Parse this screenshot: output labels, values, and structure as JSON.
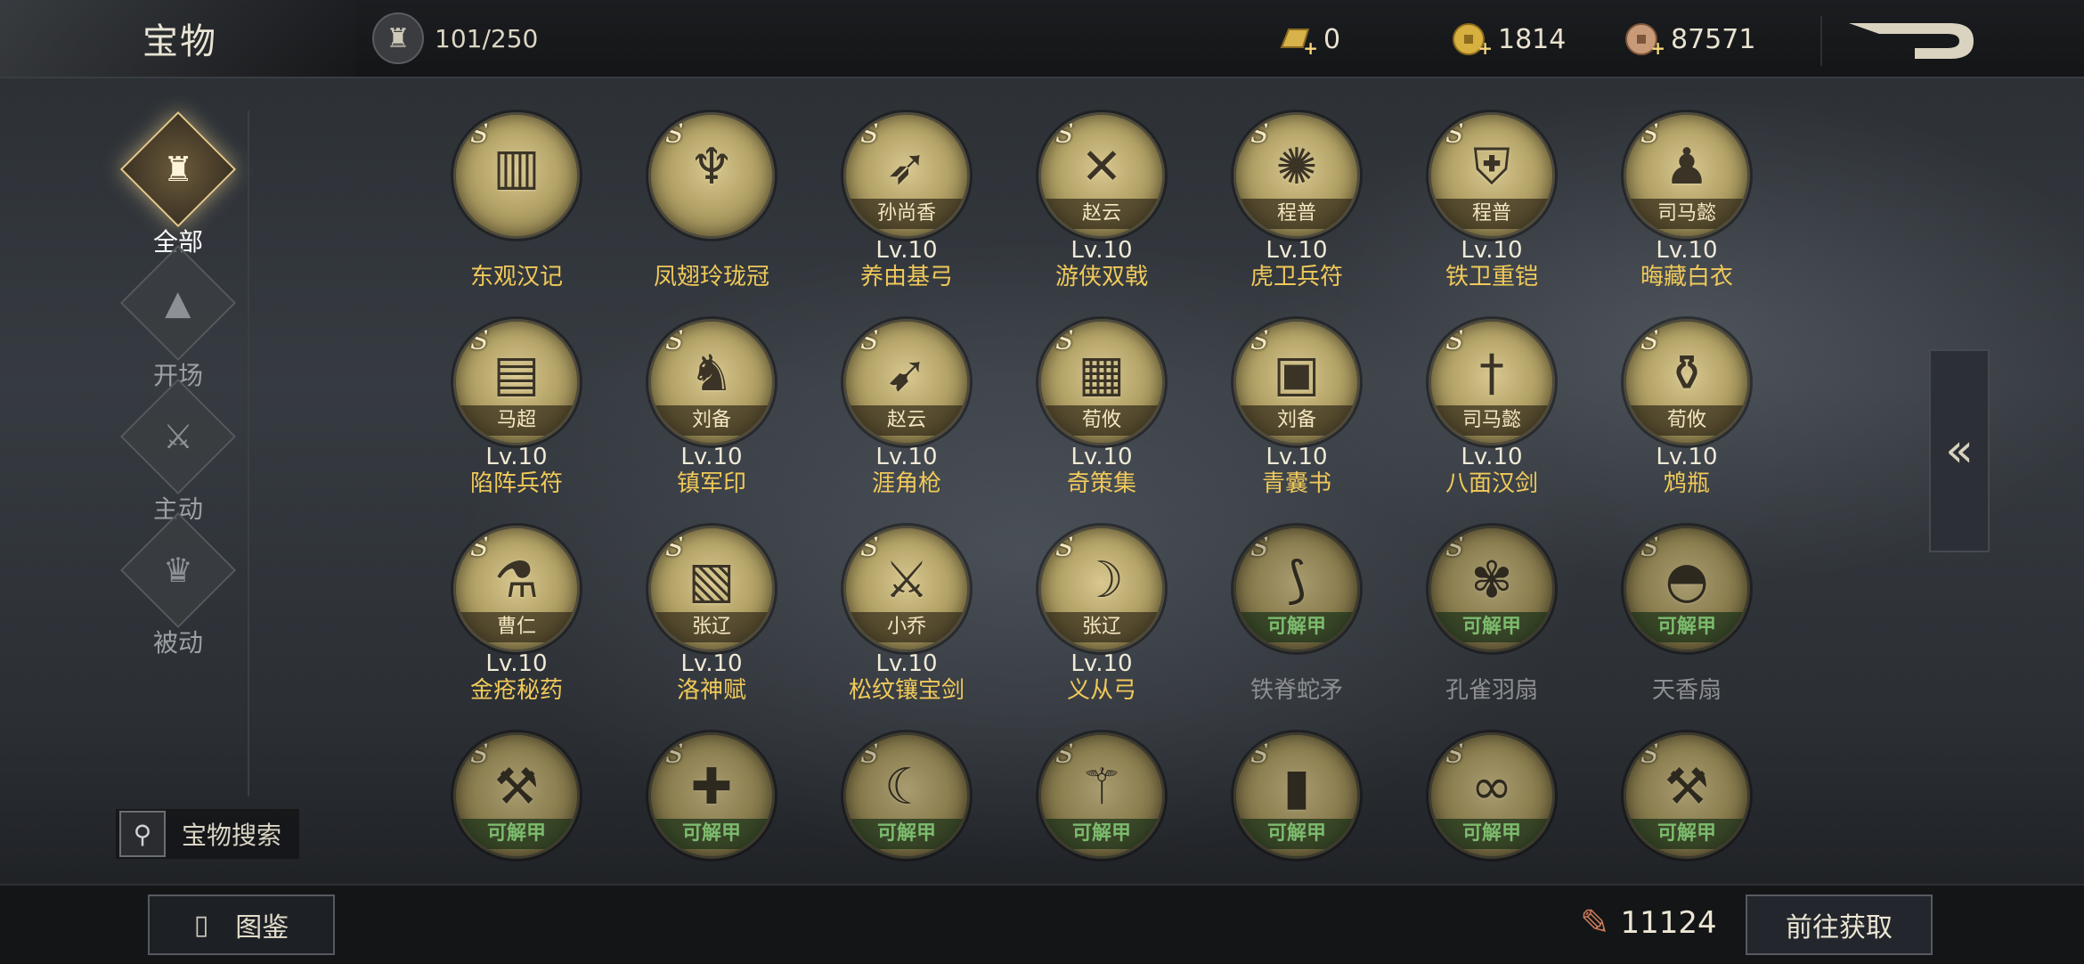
{
  "header": {
    "title": "宝物",
    "capacity": "101/250",
    "currencies": [
      {
        "icon": "gold-ingot-icon",
        "value": "0"
      },
      {
        "icon": "gold-coin-icon",
        "value": "1814"
      },
      {
        "icon": "copper-coin-icon",
        "value": "87571"
      }
    ]
  },
  "sidebar": {
    "items": [
      {
        "label": "全部",
        "icon": "all-category-icon",
        "active": true
      },
      {
        "label": "开场",
        "icon": "opening-category-icon",
        "active": false
      },
      {
        "label": "主动",
        "icon": "active-category-icon",
        "active": false
      },
      {
        "label": "被动",
        "icon": "passive-category-icon",
        "active": false
      }
    ],
    "search_label": "宝物搜索"
  },
  "treasures": [
    {
      "name": "东观汉记",
      "owner": "",
      "level": "",
      "locked": false,
      "icon": "books-icon"
    },
    {
      "name": "凤翅玲珑冠",
      "owner": "",
      "level": "",
      "locked": false,
      "icon": "phoenix-crown-icon"
    },
    {
      "name": "养由基弓",
      "owner": "孙尚香",
      "level": "Lv.10",
      "locked": false,
      "icon": "bow-icon"
    },
    {
      "name": "游侠双戟",
      "owner": "赵云",
      "level": "Lv.10",
      "locked": false,
      "icon": "twin-halberds-icon"
    },
    {
      "name": "虎卫兵符",
      "owner": "程普",
      "level": "Lv.10",
      "locked": false,
      "icon": "tiger-token-icon"
    },
    {
      "name": "铁卫重铠",
      "owner": "程普",
      "level": "Lv.10",
      "locked": false,
      "icon": "heavy-armor-icon"
    },
    {
      "name": "晦藏白衣",
      "owner": "司马懿",
      "level": "Lv.10",
      "locked": false,
      "icon": "white-robe-icon"
    },
    {
      "name": "陷阵兵符",
      "owner": "马超",
      "level": "Lv.10",
      "locked": false,
      "icon": "military-token-icon"
    },
    {
      "name": "镇军印",
      "owner": "刘备",
      "level": "Lv.10",
      "locked": false,
      "icon": "seal-icon"
    },
    {
      "name": "涯角枪",
      "owner": "赵云",
      "level": "Lv.10",
      "locked": false,
      "icon": "spear-icon"
    },
    {
      "name": "奇策集",
      "owner": "荀攸",
      "level": "Lv.10",
      "locked": false,
      "icon": "scrolls-icon"
    },
    {
      "name": "青囊书",
      "owner": "刘备",
      "level": "Lv.10",
      "locked": false,
      "icon": "green-book-icon"
    },
    {
      "name": "八面汉剑",
      "owner": "司马懿",
      "level": "Lv.10",
      "locked": false,
      "icon": "sword-icon"
    },
    {
      "name": "鸩瓶",
      "owner": "荀攸",
      "level": "Lv.10",
      "locked": false,
      "icon": "poison-vial-icon"
    },
    {
      "name": "金疮秘药",
      "owner": "曹仁",
      "level": "Lv.10",
      "locked": false,
      "icon": "medicine-flask-icon"
    },
    {
      "name": "洛神赋",
      "owner": "张辽",
      "level": "Lv.10",
      "locked": false,
      "icon": "scroll-icon"
    },
    {
      "name": "松纹镶宝剑",
      "owner": "小乔",
      "level": "Lv.10",
      "locked": false,
      "icon": "jeweled-sword-icon"
    },
    {
      "name": "义从弓",
      "owner": "张辽",
      "level": "Lv.10",
      "locked": false,
      "icon": "longbow-icon"
    },
    {
      "name": "铁脊蛇矛",
      "owner": "",
      "level": "",
      "locked": true,
      "status": "可解甲",
      "icon": "serpent-spear-icon"
    },
    {
      "name": "孔雀羽扇",
      "owner": "",
      "level": "",
      "locked": true,
      "status": "可解甲",
      "icon": "feather-fan-icon"
    },
    {
      "name": "天香扇",
      "owner": "",
      "level": "",
      "locked": true,
      "status": "可解甲",
      "icon": "folding-fan-icon"
    },
    {
      "name": "",
      "owner": "",
      "level": "",
      "locked": true,
      "status": "可解甲",
      "icon": "axe-icon"
    },
    {
      "name": "",
      "owner": "",
      "level": "",
      "locked": true,
      "status": "可解甲",
      "icon": "crossbow-icon"
    },
    {
      "name": "",
      "owner": "",
      "level": "",
      "locked": true,
      "status": "可解甲",
      "icon": "sickle-icon"
    },
    {
      "name": "",
      "owner": "",
      "level": "",
      "locked": true,
      "status": "可解甲",
      "icon": "mace-icon"
    },
    {
      "name": "",
      "owner": "",
      "level": "",
      "locked": true,
      "status": "可解甲",
      "icon": "tablets-icon"
    },
    {
      "name": "",
      "owner": "",
      "level": "",
      "locked": true,
      "status": "可解甲",
      "icon": "chain-weapon-icon"
    },
    {
      "name": "",
      "owner": "",
      "level": "",
      "locked": true,
      "status": "可解甲",
      "icon": "war-axe-icon"
    }
  ],
  "footer": {
    "codex_label": "图鉴",
    "shard_count": "11124",
    "goto_label": "前往获取"
  }
}
